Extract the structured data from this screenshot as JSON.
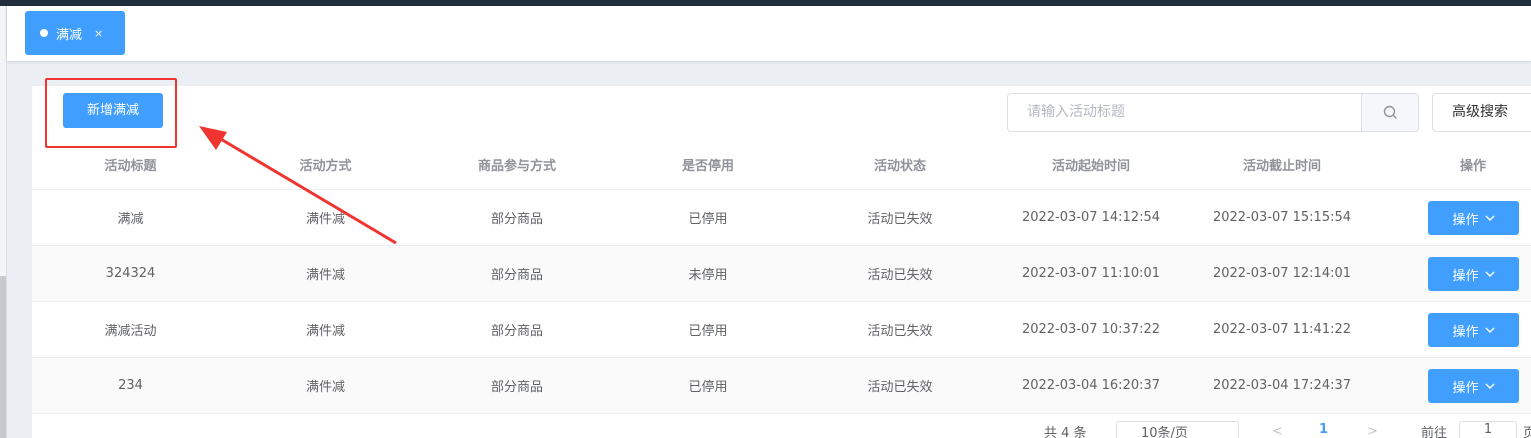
{
  "tabs": [
    {
      "label": "满减",
      "close": "×"
    }
  ],
  "toolbar": {
    "add_label": "新增满减",
    "search_placeholder": "请输入活动标题",
    "advanced_label": "高级搜索"
  },
  "table": {
    "headers": [
      "活动标题",
      "活动方式",
      "商品参与方式",
      "是否停用",
      "活动状态",
      "活动起始时间",
      "活动截止时间",
      "操作"
    ],
    "rows": [
      [
        "满减",
        "满件减",
        "部分商品",
        "已停用",
        "活动已失效",
        "2022-03-07 14:12:54",
        "2022-03-07 15:15:54"
      ],
      [
        "324324",
        "满件减",
        "部分商品",
        "未停用",
        "活动已失效",
        "2022-03-07 11:10:01",
        "2022-03-07 12:14:01"
      ],
      [
        "满减活动",
        "满件减",
        "部分商品",
        "已停用",
        "活动已失效",
        "2022-03-07 10:37:22",
        "2022-03-07 11:41:22"
      ],
      [
        "234",
        "满件减",
        "部分商品",
        "已停用",
        "活动已失效",
        "2022-03-04 16:20:37",
        "2022-03-04 17:24:37"
      ]
    ],
    "action_label": "操作"
  },
  "pagination": {
    "total": "共 4 条",
    "page_size": "10条/页",
    "prev": "<",
    "current": "1",
    "next": ">",
    "goto_label": "前往",
    "goto_value": "1",
    "goto_unit": "页"
  },
  "colors": {
    "primary": "#409eff",
    "annotation": "#f0342f"
  }
}
